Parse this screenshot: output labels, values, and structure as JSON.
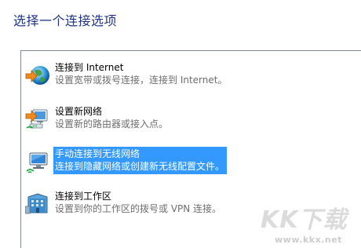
{
  "page": {
    "title": "选择一个连接选项"
  },
  "options": [
    {
      "title": "连接到 Internet",
      "description": "设置宽带或拨号连接，连接到 Internet。",
      "icon": "globe-internet-icon",
      "selected": false
    },
    {
      "title": "设置新网络",
      "description": "设置新的路由器或接入点。",
      "icon": "router-setup-icon",
      "selected": false
    },
    {
      "title": "手动连接到无线网络",
      "description": "连接到隐藏网络或创建新无线配置文件。",
      "icon": "wireless-monitor-icon",
      "selected": true
    },
    {
      "title": "连接到工作区",
      "description": "设置到你的工作区的拨号或 VPN 连接。",
      "icon": "workplace-building-icon",
      "selected": false
    }
  ],
  "watermark": {
    "logo_text": "KK下载",
    "url": "www.kkx.net"
  },
  "colors": {
    "title": "#1e3287",
    "selection": "#3399ff",
    "description": "#6d6d6d"
  }
}
